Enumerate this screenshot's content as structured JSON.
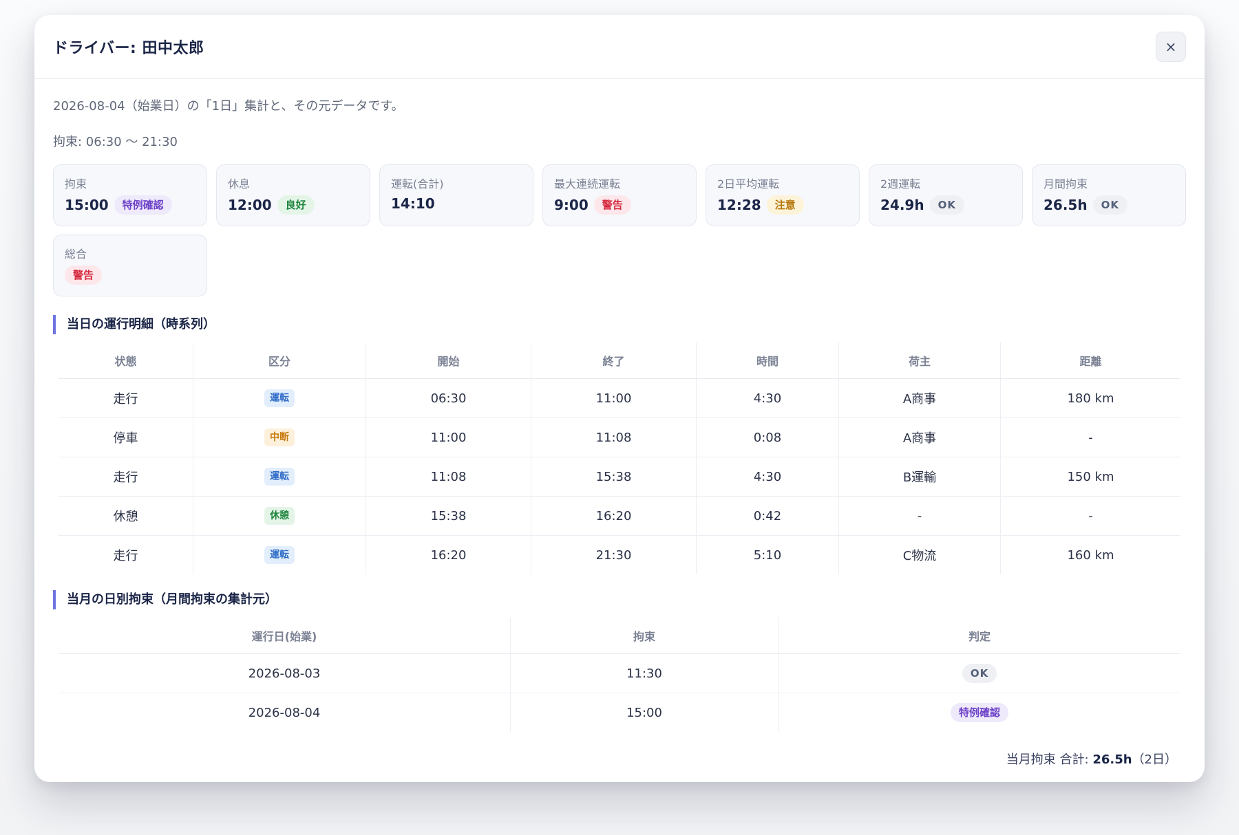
{
  "modal": {
    "title": "ドライバー: 田中太郎",
    "close_label": "×",
    "subtitle": "2026-08-04（始業日）の「1日」集計と、その元データです。",
    "period": "拘束: 06:30 〜 21:30"
  },
  "summary_cards": [
    {
      "label": "拘束",
      "value": "15:00",
      "badge": "特例確認",
      "badge_color": "#6b3fc7"
    },
    {
      "label": "休息",
      "value": "12:00",
      "badge": "良好",
      "badge_color": "#21863f"
    },
    {
      "label": "運転(合計)",
      "value": "14:10",
      "badge": "",
      "badge_color": ""
    },
    {
      "label": "最大連続運転",
      "value": "9:00",
      "badge": "警告",
      "badge_color": "#d5283e"
    },
    {
      "label": "2日平均運転",
      "value": "12:28",
      "badge": "注意",
      "badge_color": "#b7770b"
    },
    {
      "label": "2週運転",
      "value": "24.9h",
      "badge": "OK",
      "badge_color": "#55607a"
    },
    {
      "label": "月間拘束",
      "value": "26.5h",
      "badge": "OK",
      "badge_color": "#55607a"
    },
    {
      "label": "総合",
      "value": "",
      "badge": "警告",
      "badge_color": "#d5283e"
    }
  ],
  "operations": {
    "section_title": "当日の運行明細（時系列）",
    "columns": [
      "状態",
      "区分",
      "開始",
      "終了",
      "時間",
      "荷主",
      "距離"
    ],
    "rows": [
      {
        "state": "走行",
        "category": "運転",
        "category_color": "#2e6cc7",
        "start": "06:30",
        "end": "11:00",
        "duration": "4:30",
        "shipper": "A商事",
        "distance": "180 km"
      },
      {
        "state": "停車",
        "category": "中断",
        "category_color": "#c77a0b",
        "start": "11:00",
        "end": "11:08",
        "duration": "0:08",
        "shipper": "A商事",
        "distance": "-"
      },
      {
        "state": "走行",
        "category": "運転",
        "category_color": "#2e6cc7",
        "start": "11:08",
        "end": "15:38",
        "duration": "4:30",
        "shipper": "B運輸",
        "distance": "150 km"
      },
      {
        "state": "休憩",
        "category": "休憩",
        "category_color": "#21863f",
        "start": "15:38",
        "end": "16:20",
        "duration": "0:42",
        "shipper": "-",
        "distance": "-"
      },
      {
        "state": "走行",
        "category": "運転",
        "category_color": "#2e6cc7",
        "start": "16:20",
        "end": "21:30",
        "duration": "5:10",
        "shipper": "C物流",
        "distance": "160 km"
      }
    ]
  },
  "monthly": {
    "section_title": "当月の日別拘束（月間拘束の集計元）",
    "columns": [
      "運行日(始業)",
      "拘束",
      "判定"
    ],
    "rows": [
      {
        "date": "2026-08-03",
        "binding": "11:30",
        "judgement": "OK",
        "judgement_color": "#55607a"
      },
      {
        "date": "2026-08-04",
        "binding": "15:00",
        "judgement": "特例確認",
        "judgement_color": "#6b3fc7"
      }
    ],
    "total_prefix": "当月拘束 合計: ",
    "total_value": "26.5h",
    "total_suffix": "（2日）"
  }
}
